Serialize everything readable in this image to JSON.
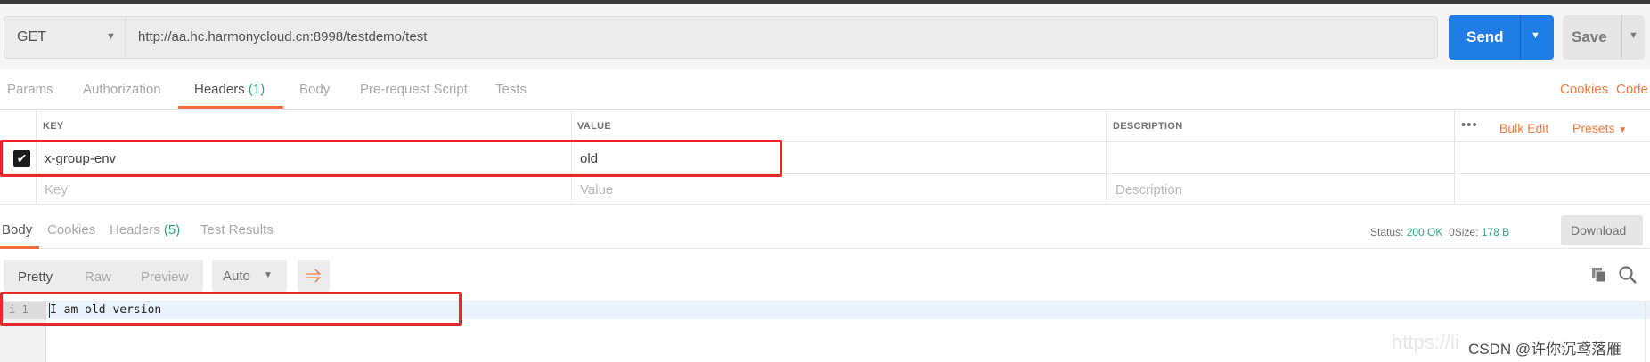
{
  "request": {
    "method": "GET",
    "url": "http://aa.hc.harmonycloud.cn:8998/testdemo/test",
    "send_label": "Send",
    "save_label": "Save"
  },
  "request_tabs": {
    "params": "Params",
    "authorization": "Authorization",
    "headers": "Headers",
    "headers_count": "(1)",
    "body": "Body",
    "prerequest": "Pre-request Script",
    "tests": "Tests",
    "cookies": "Cookies",
    "code": "Code"
  },
  "headers_table": {
    "col_key": "KEY",
    "col_value": "VALUE",
    "col_description": "DESCRIPTION",
    "more": "•••",
    "bulk_edit": "Bulk Edit",
    "presets": "Presets",
    "rows": [
      {
        "checked": true,
        "key": "x-group-env",
        "value": "old",
        "description": ""
      }
    ],
    "placeholder_key": "Key",
    "placeholder_value": "Value",
    "placeholder_description": "Description"
  },
  "response_tabs": {
    "body": "Body",
    "cookies": "Cookies",
    "headers": "Headers",
    "headers_count": "(5)",
    "test_results": "Test Results"
  },
  "response_meta": {
    "status_label": "Status:",
    "status_value": "200 OK",
    "size_label": "Size:",
    "size_prefix": "0",
    "size_value": "178 B",
    "download_label": "Download"
  },
  "response_toolbar": {
    "pretty": "Pretty",
    "raw": "Raw",
    "preview": "Preview",
    "auto": "Auto"
  },
  "code": {
    "line_info": "i 1",
    "text": "I am old version"
  },
  "watermark": "https://li",
  "credit": "CSDN @许你沉鸢落雁",
  "colors": {
    "send": "#1f7ee5",
    "accent": "#f47a3d",
    "success": "#27a77a",
    "highlight": "#e8282d"
  }
}
